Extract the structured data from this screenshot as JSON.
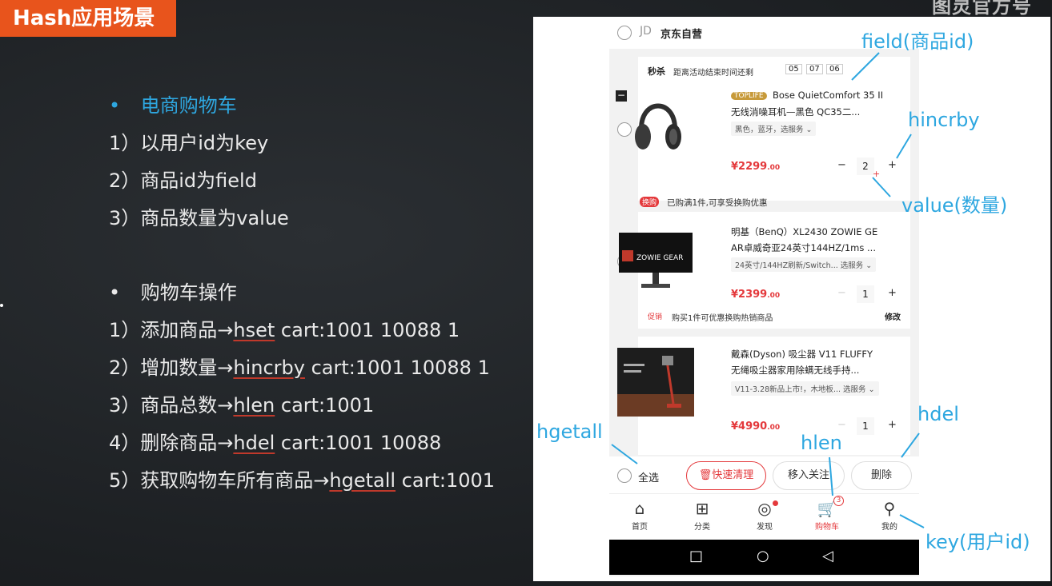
{
  "slide": {
    "title": "Hash应用场景",
    "watermark": "图灵官方号",
    "section1": {
      "bullet": "•",
      "heading": "电商购物车",
      "lines": [
        "1）以用户id为key",
        "2）商品id为field",
        "3）商品数量为value"
      ]
    },
    "section2": {
      "bullet": "•",
      "heading": "购物车操作",
      "ops": [
        {
          "prefix": "1）添加商品→",
          "cmd": "hset",
          "args": " cart:1001 10088 1"
        },
        {
          "prefix": "2）增加数量→",
          "cmd": "hincrby",
          "args": " cart:1001 10088 1"
        },
        {
          "prefix": "3）商品总数→",
          "cmd": "hlen",
          "args": " cart:1001"
        },
        {
          "prefix": "4）删除商品→",
          "cmd": "hdel",
          "args": " cart:1001 10088"
        },
        {
          "prefix": "5）获取购物车所有商品→",
          "cmd": "hgetall",
          "args": " cart:1001"
        }
      ]
    }
  },
  "phone": {
    "shop": {
      "jd": "JD",
      "name": "京东自营"
    },
    "flash": {
      "label": "秒杀",
      "text": "距离活动结束时间还剩",
      "h": "05",
      "m": "07",
      "s": "06"
    },
    "items": [
      {
        "badge": "TOPLIFE",
        "title1": "Bose QuietComfort 35 II",
        "title2": "无线消噪耳机—黑色 QC35二...",
        "spec": "黑色，蓝牙，选服务 ⌄",
        "price": "¥2299",
        "price_dec": ".00",
        "qty": "2",
        "minus": "−",
        "plus": "+"
      },
      {
        "title1": "明基（BenQ）XL2430 ZOWIE GE",
        "title2": "AR卓威奇亚24英寸144HZ/1ms ...",
        "spec": "24英寸/144HZ刷新/Switch... 选服务 ⌄",
        "price": "¥2399",
        "price_dec": ".00",
        "qty": "1",
        "minus": "−",
        "plus": "+",
        "screen_text": "ZOWIE GEAR"
      },
      {
        "title1": "戴森(Dyson) 吸尘器 V11 FLUFFY",
        "title2": "无绳吸尘器家用除螨无线手持...",
        "spec": "V11-3.28新品上市!，木地板... 选服务 ⌄",
        "price": "¥4990",
        "price_dec": ".00",
        "qty": "1",
        "minus": "−",
        "plus": "+"
      }
    ],
    "exchange": {
      "tag": "换购",
      "text": "已购满1件,可享受换购优惠"
    },
    "promo": {
      "tag": "促销",
      "text": "购买1件可优惠换购热销商品",
      "edit": "修改"
    },
    "bottom": {
      "select_all": "全选",
      "quick_clear": "快速清理",
      "move_follow": "移入关注",
      "delete": "删除"
    },
    "nav": [
      {
        "label": "首页",
        "icon": "home-icon"
      },
      {
        "label": "分类",
        "icon": "grid-icon"
      },
      {
        "label": "发现",
        "icon": "compass-icon"
      },
      {
        "label": "购物车",
        "icon": "cart-icon",
        "badge": "3"
      },
      {
        "label": "我的",
        "icon": "user-icon"
      }
    ]
  },
  "annotations": {
    "field": "field(商品id)",
    "hincrby": "hincrby",
    "value": "value(数量)",
    "hgetall": "hgetall",
    "hlen": "hlen",
    "hdel": "hdel",
    "key": "key(用户id)"
  },
  "colors": {
    "accent": "#2ea7e0",
    "title_bg": "#e8541c",
    "price": "#e4393c"
  }
}
